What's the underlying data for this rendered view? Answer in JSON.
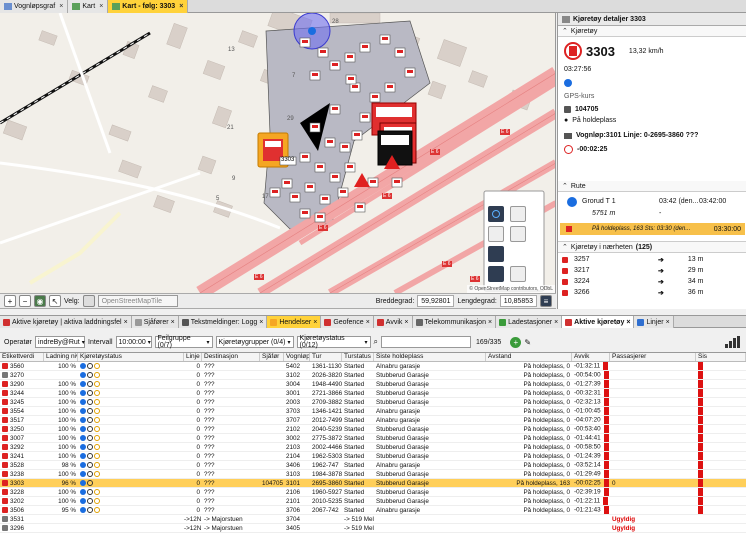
{
  "top_tabs": [
    {
      "label": "Vognløpsgraf",
      "active": false
    },
    {
      "label": "Kart",
      "active": false
    },
    {
      "label": "Kart - følg: 3303",
      "active": true
    }
  ],
  "map": {
    "zone_labels": [
      "13",
      "7",
      "29",
      "28",
      "9",
      "21",
      "5",
      "17"
    ],
    "road_labels": [
      "E 6",
      "E 6",
      "E 6",
      "E 6",
      "E 6",
      "E 6",
      "E 6"
    ],
    "focused_vehicle": "3303",
    "attribution": "© OpenStreetMap contributors, ODbL"
  },
  "map_toolbar": {
    "velg_label": "Velg:",
    "layer_placeholder": "OpenStreetMapTile",
    "breddegrad_label": "Breddegrad:",
    "breddegrad_value": "59,92801",
    "lengdegrad_label": "Lengdegrad:",
    "lengdegrad_value": "10,85853"
  },
  "right_panel": {
    "title": "Kjøretøy detaljer 3303",
    "sec_vehicle": "Kjøretøy",
    "vehicle_id": "3303",
    "speed": "13,32 km/h",
    "time": "03:27:56",
    "gps_label": "GPS-kurs",
    "driver_id": "104705",
    "status": "På holdeplass",
    "vognlop_line": "Vognløp:3101  Linje: 0-2695-3860 ???",
    "delay": "-00:02:25",
    "sec_route": "Rute",
    "route_stop": "Grorud T 1",
    "route_time1": "03:42 (den...",
    "route_time2": "03:42:00",
    "route_dist": "5751 m",
    "route_dash": "-",
    "route_current": "På holdeplass, 163  Sts: 03:30 (den...",
    "route_current_time": "03:30:00",
    "sec_nearby": "Kjøretøy i nærheten",
    "nearby_count": "(125)",
    "nearby": [
      {
        "id": "3257",
        "dist": "13 m"
      },
      {
        "id": "3217",
        "dist": "29 m"
      },
      {
        "id": "3224",
        "dist": "34 m"
      },
      {
        "id": "3266",
        "dist": "36 m"
      }
    ]
  },
  "bottom_tabs": [
    {
      "label": "Aktive kjøretøy | aktiva laddningsfel",
      "style": ""
    },
    {
      "label": "Sjåfører",
      "style": ""
    },
    {
      "label": "Tekstmeldinger: Logg",
      "style": ""
    },
    {
      "label": "Hendelser",
      "style": "active"
    },
    {
      "label": "Geofence",
      "style": ""
    },
    {
      "label": "Avvik",
      "style": ""
    },
    {
      "label": "Telekommunikasjon",
      "style": ""
    },
    {
      "label": "Ladestasjoner",
      "style": ""
    },
    {
      "label": "Aktive kjøretøy",
      "style": "bold"
    },
    {
      "label": "Linjer",
      "style": ""
    }
  ],
  "filters": {
    "operator_label": "Operatør",
    "operator_value": "indreBy@Rut",
    "interval_label": "Intervall",
    "interval_value": "10:00:00",
    "feilgruppe": "Feilgruppe (0/7)",
    "kjoretoygrupper": "Kjøretøygrupper (0/4)",
    "kjoretoystatus": "Kjøretøystatus (0/12)",
    "count": "169/335"
  },
  "table": {
    "columns": [
      "Etikettverdi",
      "Ladning nivå",
      "Kjøretøystatus",
      "Linje",
      "Destinasjon",
      "Sjåfør",
      "Vognløp",
      "Tur",
      "Turstatus",
      "Siste holdeplass",
      "Avstand",
      "Avvik",
      "Passasjerer",
      "Sis"
    ],
    "rows": [
      {
        "id": "3560",
        "lvl": "100 %",
        "linje": "0",
        "dest": "???",
        "sjafor": "",
        "vognlop": "5402",
        "tur": "1361-1130",
        "turstatus": "Started",
        "siste": "Alnabru garasje",
        "avstand": "På holdeplass, 0",
        "avvik": "-01:32:11",
        "pass": "",
        "sel": false
      },
      {
        "id": "3270",
        "lvl": "",
        "linje": "0",
        "dest": "???",
        "sjafor": "",
        "vognlop": "3102",
        "tur": "2026-3820",
        "turstatus": "Started",
        "siste": "Stubberud Garasje",
        "avstand": "På holdeplass, 0",
        "avvik": "-00:54:00",
        "pass": "",
        "sel": false
      },
      {
        "id": "3290",
        "lvl": "100 %",
        "linje": "0",
        "dest": "???",
        "sjafor": "",
        "vognlop": "3004",
        "tur": "1948-4490",
        "turstatus": "Started",
        "siste": "Stubberud Garasje",
        "avstand": "På holdeplass, 0",
        "avvik": "-01:27:39",
        "pass": "",
        "sel": false
      },
      {
        "id": "3244",
        "lvl": "100 %",
        "linje": "0",
        "dest": "???",
        "sjafor": "",
        "vognlop": "3001",
        "tur": "2721-3866",
        "turstatus": "Started",
        "siste": "Stubberud Garasje",
        "avstand": "På holdeplass, 0",
        "avvik": "-00:32:31",
        "pass": "",
        "sel": false
      },
      {
        "id": "3245",
        "lvl": "100 %",
        "linje": "0",
        "dest": "???",
        "sjafor": "",
        "vognlop": "2003",
        "tur": "2709-3882",
        "turstatus": "Started",
        "siste": "Stubberud Garasje",
        "avstand": "På holdeplass, 0",
        "avvik": "-02:32:13",
        "pass": "",
        "sel": false
      },
      {
        "id": "3554",
        "lvl": "100 %",
        "linje": "0",
        "dest": "???",
        "sjafor": "",
        "vognlop": "3703",
        "tur": "1346-1421",
        "turstatus": "Started",
        "siste": "Alnabru garasje",
        "avstand": "På holdeplass, 0",
        "avvik": "-01:00:45",
        "pass": "",
        "sel": false
      },
      {
        "id": "3517",
        "lvl": "100 %",
        "linje": "0",
        "dest": "???",
        "sjafor": "",
        "vognlop": "3707",
        "tur": "2012-7499",
        "turstatus": "Started",
        "siste": "Alnabru garasje",
        "avstand": "På holdeplass, 0",
        "avvik": "-04:07:20",
        "pass": "",
        "sel": false
      },
      {
        "id": "3250",
        "lvl": "100 %",
        "linje": "0",
        "dest": "???",
        "sjafor": "",
        "vognlop": "2102",
        "tur": "2040-5239",
        "turstatus": "Started",
        "siste": "Stubberud Garasje",
        "avstand": "På holdeplass, 0",
        "avvik": "-00:53:40",
        "pass": "",
        "sel": false
      },
      {
        "id": "3007",
        "lvl": "100 %",
        "linje": "0",
        "dest": "???",
        "sjafor": "",
        "vognlop": "3002",
        "tur": "2775-3872",
        "turstatus": "Started",
        "siste": "Stubberud Garasje",
        "avstand": "På holdeplass, 0",
        "avvik": "-01:44:41",
        "pass": "",
        "sel": false
      },
      {
        "id": "3292",
        "lvl": "100 %",
        "linje": "0",
        "dest": "???",
        "sjafor": "",
        "vognlop": "2103",
        "tur": "2002-4466",
        "turstatus": "Started",
        "siste": "Stubberud Garasje",
        "avstand": "På holdeplass, 0",
        "avvik": "-00:58:50",
        "pass": "",
        "sel": false
      },
      {
        "id": "3241",
        "lvl": "100 %",
        "linje": "0",
        "dest": "???",
        "sjafor": "",
        "vognlop": "2104",
        "tur": "1962-5303",
        "turstatus": "Started",
        "siste": "Stubberud Garasje",
        "avstand": "På holdeplass, 0",
        "avvik": "-01:24:39",
        "pass": "",
        "sel": false
      },
      {
        "id": "3528",
        "lvl": "98 %",
        "linje": "0",
        "dest": "???",
        "sjafor": "",
        "vognlop": "3406",
        "tur": "1962-747",
        "turstatus": "Started",
        "siste": "Alnabru garasje",
        "avstand": "På holdeplass, 0",
        "avvik": "-03:52:14",
        "pass": "",
        "sel": false
      },
      {
        "id": "3238",
        "lvl": "100 %",
        "linje": "0",
        "dest": "???",
        "sjafor": "",
        "vognlop": "3103",
        "tur": "1984-3878",
        "turstatus": "Started",
        "siste": "Stubberud Garasje",
        "avstand": "På holdeplass, 0",
        "avvik": "-01:29:49",
        "pass": "",
        "sel": false
      },
      {
        "id": "3303",
        "lvl": "96 %",
        "linje": "0",
        "dest": "???",
        "sjafor": "104705",
        "vognlop": "3101",
        "tur": "2695-3860",
        "turstatus": "Started",
        "siste": "Stubberud Garasje",
        "avstand": "På holdeplass, 163",
        "avvik": "-00:02:25",
        "pass": "0",
        "sel": true
      },
      {
        "id": "3228",
        "lvl": "100 %",
        "linje": "0",
        "dest": "???",
        "sjafor": "",
        "vognlop": "2106",
        "tur": "1960-5927",
        "turstatus": "Started",
        "siste": "Stubberud Garasje",
        "avstand": "På holdeplass, 0",
        "avvik": "-02:39:19",
        "pass": "",
        "sel": false
      },
      {
        "id": "3202",
        "lvl": "100 %",
        "linje": "0",
        "dest": "???",
        "sjafor": "",
        "vognlop": "2101",
        "tur": "2010-5235",
        "turstatus": "Started",
        "siste": "Stubberud Garasje",
        "avstand": "På holdeplass, 0",
        "avvik": "-01:22:11",
        "pass": "",
        "sel": false
      },
      {
        "id": "3506",
        "lvl": "95 %",
        "linje": "0",
        "dest": "???",
        "sjafor": "",
        "vognlop": "3706",
        "tur": "2067-742",
        "turstatus": "Started",
        "siste": "Alnabru garasje",
        "avstand": "På holdeplass, 0",
        "avvik": "-01:21:43",
        "pass": "",
        "sel": false
      },
      {
        "id": "3531",
        "lvl": "",
        "linje": "->12N",
        "dest": "-> Majorstuen",
        "sjafor": "",
        "vognlop": "3704",
        "tur": "",
        "turstatus": "-> 519 Mellom",
        "siste": "",
        "avstand": "",
        "avvik": "",
        "pass": "Ugyldig",
        "sel": false
      },
      {
        "id": "3296",
        "lvl": "",
        "linje": "->12N",
        "dest": "-> Majorstuen",
        "sjafor": "",
        "vognlop": "3405",
        "tur": "",
        "turstatus": "-> 519 Mellom",
        "siste": "",
        "avstand": "",
        "avvik": "",
        "pass": "Ugyldig",
        "sel": false
      }
    ]
  }
}
